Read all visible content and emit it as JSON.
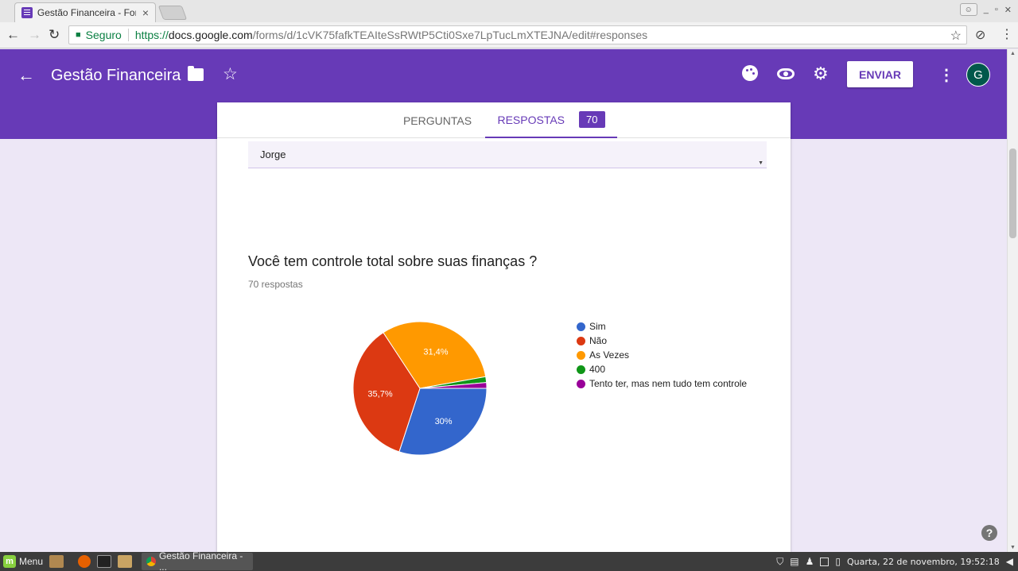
{
  "browser": {
    "tab_title": "Gestão Financeira - For",
    "tab_close": "×",
    "secure_label": "Seguro",
    "url_scheme": "https://",
    "url_domain": "docs.google.com",
    "url_path": "/forms/d/1cVK75fafkTEAIteSsRWtP5Cti0Sxe7LpTucLmXTEJNA/edit#responses"
  },
  "header": {
    "title": "Gestão Financeira",
    "send_label": "ENVIAR",
    "avatar_initial": "G",
    "color": "#673ab7"
  },
  "tabs": {
    "questions": "PERGUNTAS",
    "responses": "RESPOSTAS",
    "responses_count": "70"
  },
  "dropdown": {
    "value": "Jorge"
  },
  "question": {
    "title": "Você tem controle total sobre suas finanças ?",
    "count": "70 respostas"
  },
  "chart_data": {
    "type": "pie",
    "categories": [
      "Sim",
      "Não",
      "As Vezes",
      "400",
      "Tento ter, mas nem tudo tem controle"
    ],
    "values": [
      30,
      35.7,
      31.4,
      1.4,
      1.4
    ],
    "labels": [
      "30%",
      "35,7%",
      "31,4%",
      "",
      ""
    ],
    "colors": [
      "#3366cc",
      "#dc3912",
      "#ff9900",
      "#109618",
      "#990099"
    ],
    "legend_position": "right"
  },
  "taskbar": {
    "menu_label": "Menu",
    "window_label": "Gestão Financeira - ...",
    "clock": "Quarta, 22 de novembro, 19:52:18"
  }
}
